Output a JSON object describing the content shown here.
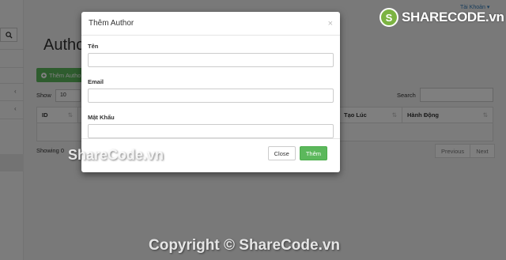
{
  "header": {
    "account_label": "Tài Khoản ▾"
  },
  "page": {
    "title": "Author",
    "add_button_label": "Thêm Author",
    "show_label": "Show",
    "show_value": "10",
    "search_label": "Search",
    "showing_text": "Showing 0",
    "pagination": {
      "previous": "Previous",
      "next": "Next"
    }
  },
  "table": {
    "columns": [
      {
        "label": "ID"
      },
      {
        "label": "Tạo Lúc"
      },
      {
        "label": "Hành Động"
      }
    ],
    "sort_icon": "⇅"
  },
  "modal": {
    "title": "Thêm Author",
    "close_symbol": "×",
    "fields": [
      {
        "label": "Tên",
        "value": ""
      },
      {
        "label": "Email",
        "value": ""
      },
      {
        "label": "Mật Khẩu",
        "value": ""
      }
    ],
    "close_button": "Close",
    "submit_button": "Thêm"
  },
  "watermark": {
    "logo_text": "SHARECODE.vn",
    "mid_text": "ShareCode.vn",
    "bottom_text": "Copyright © ShareCode.vn"
  },
  "colors": {
    "success": "#5cb85c",
    "link": "#337ab7",
    "overlay": "rgba(0,0,0,0.5)"
  },
  "icons": {
    "search": "search-icon",
    "plus": "plus-circle-icon",
    "close": "close-icon"
  }
}
